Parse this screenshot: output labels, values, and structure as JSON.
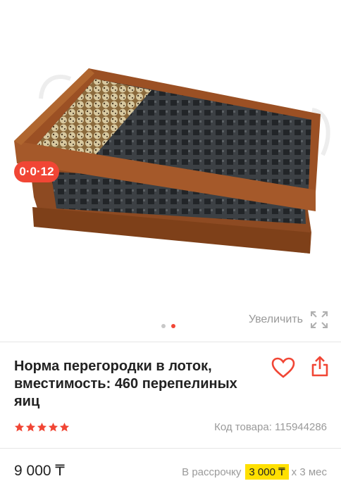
{
  "gallery": {
    "image_alt": "Wooden tray with quail eggs and dark plastic dividers",
    "zoom_label": "Увеличить",
    "zoom_icon": "expand-icon",
    "dots_total": 2,
    "dots_active_index": 1
  },
  "badge": {
    "text": "0·0·12"
  },
  "product": {
    "title": "Норма перегородки в лоток, вместимость: 460 перепелиных яиц",
    "rating_stars": 5,
    "sku_label": "Код товара: 115944286",
    "favorite_icon": "heart-icon",
    "share_icon": "share-icon"
  },
  "pricing": {
    "price": "9 000 ₸",
    "installment_prefix": "В рассрочку",
    "installment_amount": "3 000 ₸",
    "installment_suffix": "х 3 мес"
  },
  "colors": {
    "accent": "#f14635",
    "installment_highlight": "#ffe000",
    "muted_text": "#9a9a9a",
    "wood": "#9b5024"
  }
}
